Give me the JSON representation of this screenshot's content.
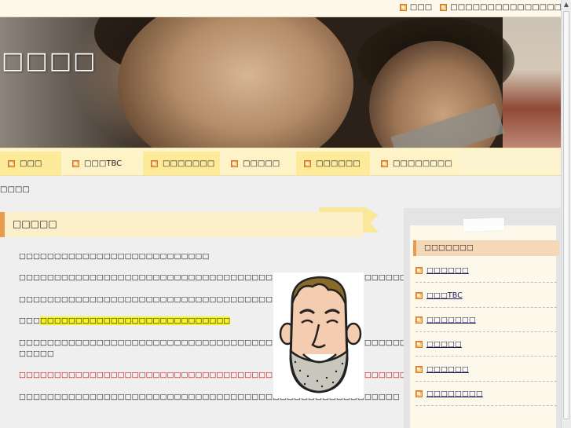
{
  "topbar": {
    "links": [
      {
        "label": "□□□",
        "icon": "note-icon"
      },
      {
        "label": "□□□□□□□□□□□□□□□",
        "icon": "note-icon"
      }
    ]
  },
  "header": {
    "site_title": "□□□□"
  },
  "nav": {
    "items": [
      {
        "label": "□□□"
      },
      {
        "label": "□□□TBC"
      },
      {
        "label": "□□□□□□□"
      },
      {
        "label": "□□□□□"
      },
      {
        "label": "□□□□□□"
      },
      {
        "label": "□□□□□□□□"
      }
    ]
  },
  "breadcrumb": "□□□□",
  "main": {
    "section_title": "□□□□□",
    "paragraphs": {
      "p1": "□□□□□□□□□□□□□□□□□□□□□□□□□□□",
      "p2": "□□□□□□□□□□□□□□□□□□□□□□□□□□□□□□□□□□□□□□□□□□□□□□□□□□□□□□□□□□□",
      "p3": "□□□□□□□□□□□□□□□□□□□□□□□□□□□□□□□□□□□□□□□□□□□",
      "p4_prefix": "□□□",
      "p4_highlight": "□□□□□□□□□□□□□□□□□□□□□□□□□□□",
      "p5_line1": "□□□□□□□□□□□□□□□□□□□□□□□□□□□□□□□□□□□□□□□□□□□□□□□□□□□□□□□□□□□□□□□□□",
      "p5_line2": "□□□□□",
      "p6_red": "□□□□□□□□□□□□□□□□□□□□□□□□□□□□□□□□□□□□□□□□□□□□□□□□□□□□□□□□□□□□",
      "p7": "□□□□□□□□□□□□□□□□□□□□□□□□□□□□□□□□□□□□□□□□□□□□□□□□□□□□□□"
    }
  },
  "sidebar": {
    "heading": "□□□□□□□",
    "items": [
      {
        "label": "□□□□□□"
      },
      {
        "label": "□□□TBC"
      },
      {
        "label": "□□□□□□□"
      },
      {
        "label": "□□□□□"
      },
      {
        "label": "□□□□□□"
      },
      {
        "label": "□□□□□□□□"
      }
    ]
  },
  "colors": {
    "accent_orange": "#e99a4f",
    "nav_bg": "#fbf4cf",
    "highlight_yellow": "#f5f322",
    "text_red": "#c00000"
  }
}
